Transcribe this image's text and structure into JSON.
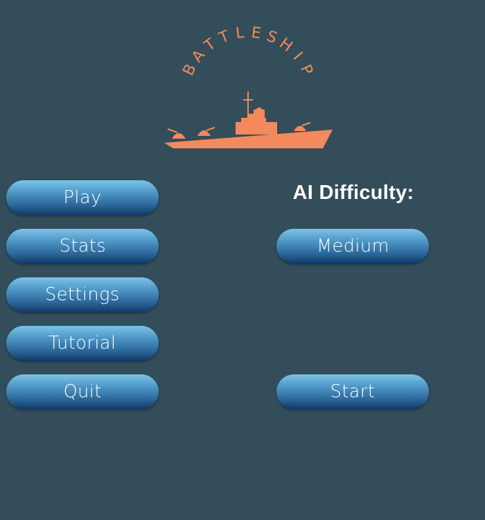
{
  "app": {
    "logo_text": "BATTLESHIP",
    "logo_color": "#f4895c",
    "background_color": "#344d5a"
  },
  "menu": {
    "play_label": "Play",
    "stats_label": "Stats",
    "settings_label": "Settings",
    "tutorial_label": "Tutorial",
    "quit_label": "Quit"
  },
  "difficulty": {
    "heading": "AI Difficulty:",
    "selected": "Medium"
  },
  "actions": {
    "start_label": "Start"
  }
}
